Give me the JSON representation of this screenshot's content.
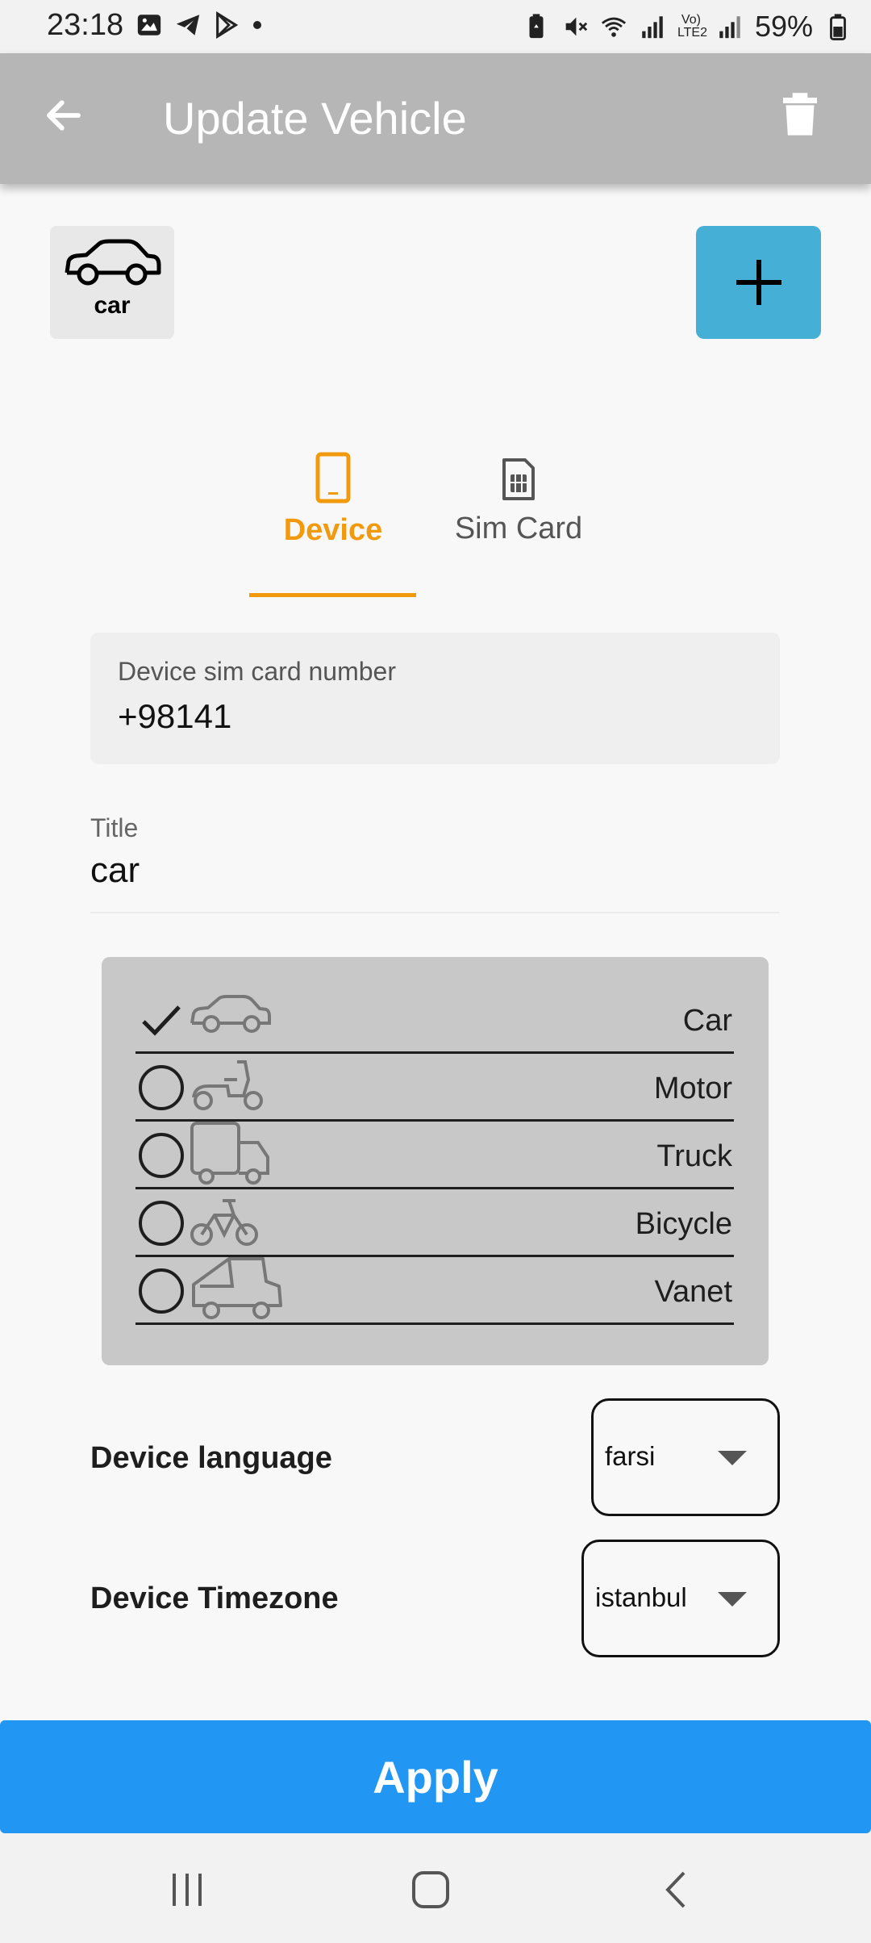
{
  "status_bar": {
    "time": "23:18",
    "battery": "59%",
    "icons": [
      "image-icon",
      "telegram-icon",
      "play-store-icon",
      "dot-icon",
      "battery-saver-icon",
      "mute-icon",
      "wifi-icon",
      "signal-icon",
      "volte-icon",
      "signal-icon",
      "battery-icon"
    ],
    "volte_label": "Vo) LTE2"
  },
  "app_bar": {
    "title": "Update Vehicle",
    "back_icon": "arrow-left-icon",
    "delete_icon": "trash-icon"
  },
  "vehicle_thumb": {
    "label": "car",
    "icon": "car-icon"
  },
  "add_button": {
    "icon": "plus-icon"
  },
  "tabs": [
    {
      "label": "Device",
      "icon": "smartphone-icon",
      "active": true
    },
    {
      "label": "Sim Card",
      "icon": "sim-card-icon",
      "active": false
    }
  ],
  "sim_field": {
    "label": "Device sim card number",
    "value": "+98141"
  },
  "title_field": {
    "label": "Title",
    "value": "car"
  },
  "vehicle_types": [
    {
      "label": "Car",
      "icon": "car-icon",
      "selected": true
    },
    {
      "label": "Motor",
      "icon": "scooter-icon",
      "selected": false
    },
    {
      "label": "Truck",
      "icon": "truck-icon",
      "selected": false
    },
    {
      "label": "Bicycle",
      "icon": "bicycle-icon",
      "selected": false
    },
    {
      "label": "Vanet",
      "icon": "van-icon",
      "selected": false
    }
  ],
  "settings": {
    "language_label": "Device language",
    "language_value": "farsi",
    "timezone_label": "Device Timezone",
    "timezone_value": "istanbul"
  },
  "apply_label": "Apply",
  "nav": [
    "recent-apps-icon",
    "home-icon",
    "back-icon"
  ],
  "colors": {
    "accent": "#f29a0e",
    "primary": "#2196f3",
    "add_button": "#45afd5",
    "app_bar": "#b6b6b6"
  }
}
